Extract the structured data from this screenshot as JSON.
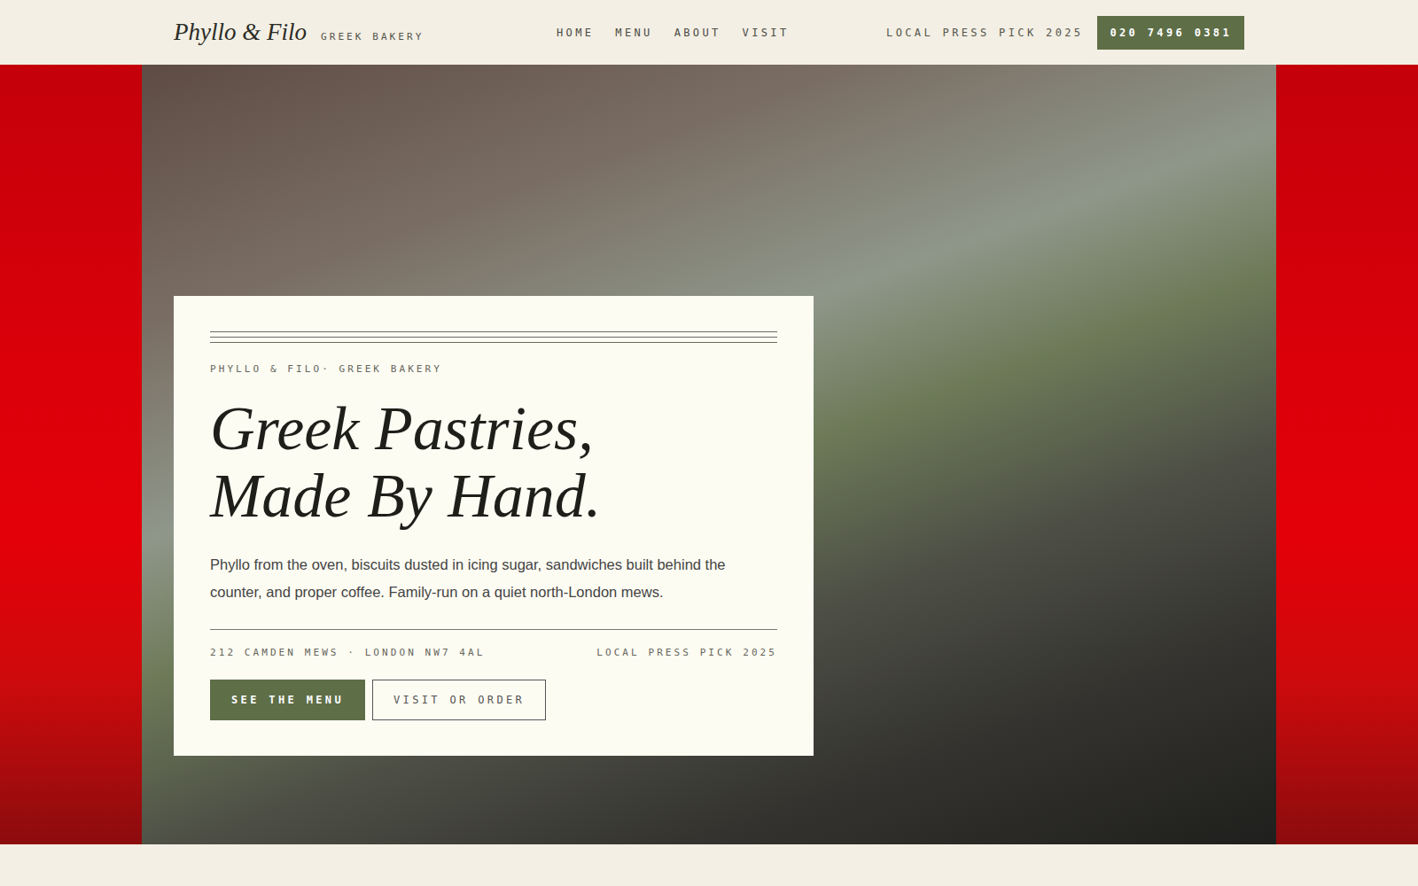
{
  "brand": {
    "name": "Phyllo & Filo",
    "tagline": "GREEK BAKERY"
  },
  "nav": [
    "HOME",
    "MENU",
    "ABOUT",
    "VISIT"
  ],
  "header": {
    "badge": "LOCAL PRESS PICK 2025",
    "phone": "020 7496 0381"
  },
  "hero": {
    "eyebrow": "PHYLLO & FILO· GREEK BAKERY",
    "title_lines": [
      "Greek Pastries,",
      "Made By Hand."
    ],
    "body": "Phyllo from the oven, biscuits dusted in icing sugar, sandwiches built behind the counter, and proper coffee. Family-run on a quiet north-London mews.",
    "address": "212 CAMDEN MEWS · LONDON NW7 4AL",
    "badge": "LOCAL PRESS PICK 2025",
    "buttons": [
      "SEE THE MENU",
      "VISIT OR ORDER"
    ]
  }
}
